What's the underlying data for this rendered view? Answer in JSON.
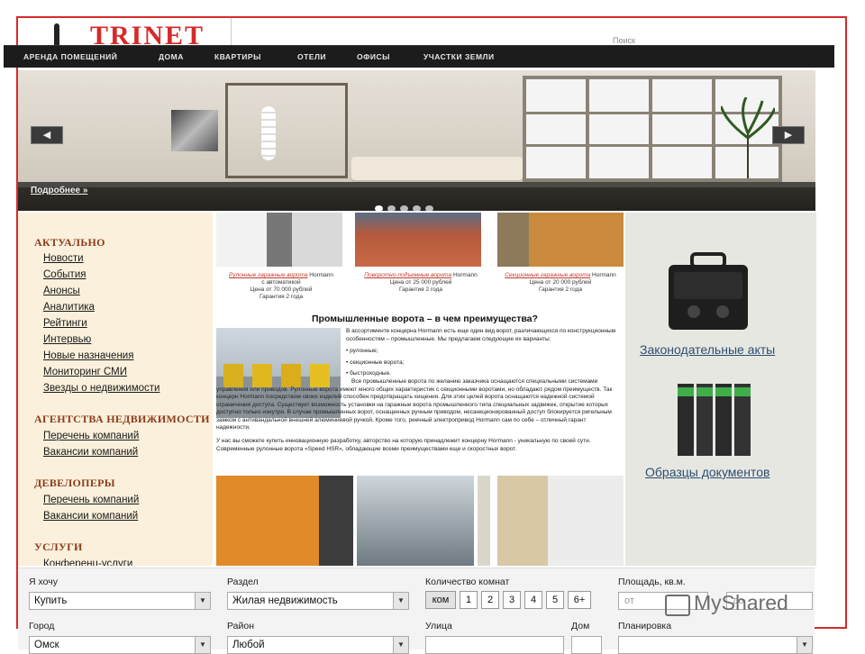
{
  "header": {
    "logo_text": "TRINET",
    "top_right_text": "Поиск"
  },
  "nav": {
    "items": [
      {
        "label": "АРЕНДА ПОМЕЩЕНИЙ"
      },
      {
        "label": "ДОМА"
      },
      {
        "label": "КВАРТИРЫ"
      },
      {
        "label": "ОТЕЛИ"
      },
      {
        "label": "ОФИСЫ"
      },
      {
        "label": "УЧАСТКИ ЗЕМЛИ"
      }
    ]
  },
  "banner": {
    "prev_label": "◀",
    "next_label": "▶",
    "more_label": "Подробнее »",
    "slides_count": 5,
    "active_slide": 1
  },
  "sidebar": {
    "sections": [
      {
        "title": "АКТУАЛЬНО",
        "links": [
          "Новости",
          "События",
          "Анонсы",
          "Аналитика",
          "Рейтинги",
          "Интервью",
          "Новые назначения",
          "Мониторинг СМИ",
          "Звезды о недвижимости"
        ]
      },
      {
        "title": "АГЕНТСТВА НЕДВИЖИМОСТИ",
        "links": [
          "Перечень компаний",
          "Вакансии компаний"
        ]
      },
      {
        "title": "ДЕВЕЛОПЕРЫ",
        "links": [
          "Перечень компаний",
          "Вакансии компаний"
        ]
      },
      {
        "title": "УСЛУГИ",
        "links": [
          "Конференц-услуги"
        ]
      }
    ]
  },
  "content": {
    "products": [
      {
        "name": "Рулонные гаражные ворота",
        "brand": "Hormann",
        "note": "с автоматикой",
        "price": "Цена от 70 000 рублей",
        "warranty": "Гарантия 2 года"
      },
      {
        "name": "Поворотно-подъемные ворота",
        "brand": "Hormann",
        "note": "",
        "price": "Цена от 25 000 рублей",
        "warranty": "Гарантия 2 года"
      },
      {
        "name": "Секционные гаражные ворота",
        "brand": "Hormann",
        "note": "",
        "price": "Цена от 20 000 рублей",
        "warranty": "Гарантия 2 года"
      }
    ],
    "article_title": "Промышленные ворота – в чем преимущества?",
    "intro": "В ассортименте концерна Hormann есть еще один вид ворот, различающихся по конструкционным особенностям – промышленные. Мы предлагаем следующие их варианты:",
    "bullets": [
      "рулонные;",
      "секционные ворота;",
      "быстроходные."
    ],
    "para1": "Все промышленные ворота по желанию заказчика оснащаются специальными системами управления или приводов. Рулонные ворота имеют много общих характеристик с секционными воротами, но обладают рядом преимуществ. Так концерн Hormann посредством своих изделий способен предотвращать хищения. Для этих целей ворота оснащаются надежной системой ограничения доступа. Существует возможность установки на гаражные ворота промышленного типа специальных задвижек, открытие которых доступно только изнутри. В случае промышленных ворот, оснащенных ручным приводом, несанкционированный доступ блокируется ригельным замком с антивандальной внешней алюминиевой ручкой. Кроме того, реечный электропривод Hormann сам по себе – отличный гарант надежности.",
    "para2": "У нас вы сможете купить инновационную разработку, авторство на которую принадлежит концерну Hormann - уникальную по своей сути. Современные рулонные ворота «Speed HSR», обладающие всеми преимуществами еще и скоростных ворот."
  },
  "right_column": {
    "link1": "Законодательные акты",
    "link2": "Образцы документов"
  },
  "search": {
    "want_label": "Я хочу",
    "want_value": "Купить",
    "section_label": "Раздел",
    "section_value": "Жилая недвижимость",
    "rooms_label": "Количество комнат",
    "rooms_options": [
      "ком",
      "1",
      "2",
      "3",
      "4",
      "5",
      "6+"
    ],
    "area_label": "Площадь, кв.м.",
    "area_from_placeholder": "от",
    "area_to_placeholder": "до",
    "city_label": "Город",
    "city_value": "Омск",
    "district_label": "Район",
    "district_value": "Любой",
    "street_label": "Улица",
    "house_label": "Дом",
    "plan_label": "Планировка"
  },
  "watermark": {
    "text": "MyShared"
  },
  "colors": {
    "frame_red": "#d52a2a",
    "nav_bg": "#1c1c1c",
    "sidebar_bg": "#faf0dc",
    "section_title": "#8c3b1a",
    "right_link": "#2c4f6f"
  }
}
